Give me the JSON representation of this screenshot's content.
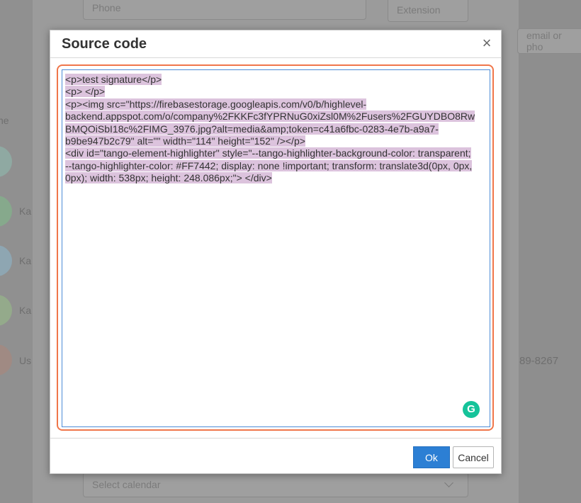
{
  "background": {
    "phone_placeholder": "Phone",
    "extension_placeholder": "Extension",
    "search_placeholder": "email or pho",
    "users": [
      {
        "name": "",
        "color": "#8fa9a2"
      },
      {
        "name": "Ka",
        "color": "#86a98c"
      },
      {
        "name": "Ka",
        "color": "#8ea6b2"
      },
      {
        "name": "Ka",
        "color": "#94aa8b"
      },
      {
        "name": "Us",
        "color": "#a08a83"
      }
    ],
    "side_label": "ne",
    "phone_number": "89-8267",
    "calendar_placeholder": "Select calendar"
  },
  "modal": {
    "title": "Source code",
    "close_icon": "close-icon",
    "code_lines": [
      "<p>test signature</p>",
      "<p> </p>",
      "<p><img src=\"https://firebasestorage.googleapis.com/v0/b/highlevel-",
      "backend.appspot.com/o/company%2FKKFc3fYPRNuG0xiZsl0M%2Fusers%2FGUYDBO8Rw",
      "BMQOiSbI18c%2FIMG_3976.jpg?alt=media&amp;token=c41a6fbc-0283-4e7b-a9a7-",
      "b9be947b2c79\" alt=\"\" width=\"114\" height=\"152\" /></p>",
      "<div id=\"tango-element-highlighter\" style=\"--tango-highlighter-background-color: transparent;",
      "--tango-highlighter-color: #FF7442; display: none !important; transform: translate3d(0px, 0px,",
      "0px); width: 538px; height: 248.086px;\"> </div>"
    ],
    "grammarly_icon": "G",
    "ok_label": "Ok",
    "cancel_label": "Cancel",
    "colors": {
      "highlight_border": "#f0764a",
      "selection": "#dcc3dd",
      "ok_button": "#2c7fd4",
      "grammarly": "#15c39a"
    }
  }
}
